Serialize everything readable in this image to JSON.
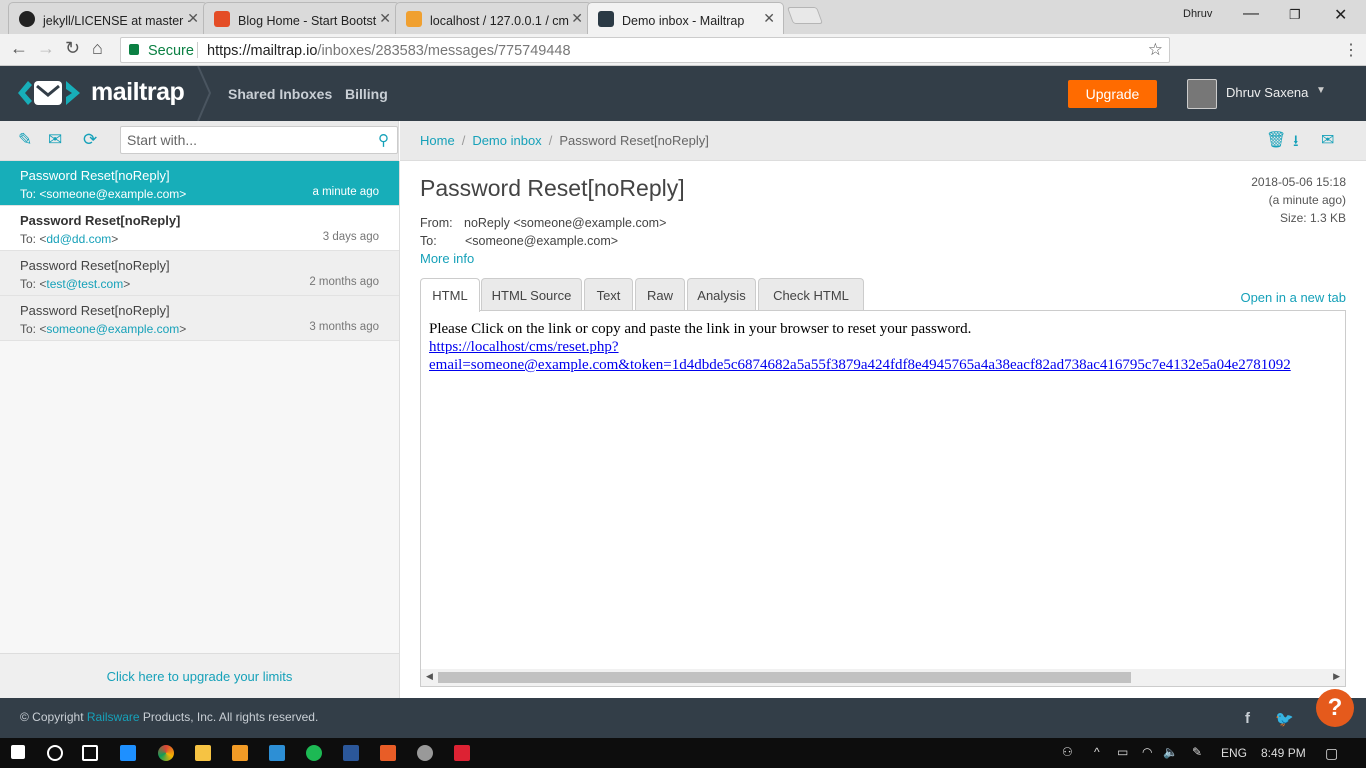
{
  "browser": {
    "tabs": [
      {
        "title": "jekyll/LICENSE at master ·",
        "favicon": "github-icon",
        "active": false
      },
      {
        "title": "Blog Home - Start Bootst",
        "favicon": "html5-icon",
        "active": false
      },
      {
        "title": "localhost / 127.0.0.1 / cm",
        "favicon": "phpmyadmin-icon",
        "active": false
      },
      {
        "title": "Demo inbox - Mailtrap",
        "favicon": "mailtrap-icon",
        "active": true
      }
    ],
    "profile_name": "Dhruv",
    "security_label": "Secure",
    "url_base": "https://mailtrap.io",
    "url_path": "/inboxes/283583/messages/775749448"
  },
  "header": {
    "logo_text": "mailtrap",
    "nav": [
      "Shared Inboxes",
      "Billing"
    ],
    "upgrade_label": "Upgrade",
    "user_name": "Dhruv Saxena"
  },
  "sidebar": {
    "search_placeholder": "Start with...",
    "messages": [
      {
        "subject": "Password Reset[noReply]",
        "to_prefix": "To: ",
        "to_email": "<someone@example.com>",
        "time": "a minute ago",
        "state": "selected"
      },
      {
        "subject": "Password Reset[noReply]",
        "to_prefix": "To: <",
        "to_email": "dd@dd.com",
        "to_suffix": ">",
        "time": "3 days ago",
        "state": "unread"
      },
      {
        "subject": "Password Reset[noReply]",
        "to_prefix": "To: <",
        "to_email": "test@test.com",
        "to_suffix": ">",
        "time": "2 months ago",
        "state": "read"
      },
      {
        "subject": "Password Reset[noReply]",
        "to_prefix": "To: <",
        "to_email": "someone@example.com",
        "to_suffix": ">",
        "time": "3 months ago",
        "state": "read"
      }
    ],
    "upgrade_limits": "Click here to upgrade your limits"
  },
  "message": {
    "breadcrumb": [
      "Home",
      "Demo inbox",
      "Password Reset[noReply]"
    ],
    "subject": "Password Reset[noReply]",
    "date": "2018-05-06 15:18",
    "relative": "(a minute ago)",
    "size": "Size: 1.3 KB",
    "from_label": "From:",
    "from_value": "noReply <someone@example.com>",
    "to_label": "To:",
    "to_value": "<someone@example.com>",
    "more_info": "More info",
    "tabs": [
      "HTML",
      "HTML Source",
      "Text",
      "Raw",
      "Analysis",
      "Check HTML"
    ],
    "active_tab": "HTML",
    "open_new_tab": "Open in a new tab",
    "body_text": "Please Click on the link or copy and paste the link in your browser to reset your password.",
    "link_line1": "https://localhost/cms/reset.php?",
    "link_line2": "email=someone@example.com&token=1d4dbde5c6874682a5a55f3879a424fdf8e4945765a4a38eacf82ad738ac416795c7e4132e5a04e2781092"
  },
  "footer": {
    "copyright_prefix": "© Copyright ",
    "copyright_link": "Railsware",
    "copyright_suffix": " Products, Inc. All rights reserved."
  },
  "taskbar": {
    "language": "ENG",
    "time": "8:49 PM"
  },
  "colors": {
    "accent": "#17aeb9",
    "header_bg": "#333e48",
    "upgrade": "#ff6b00"
  }
}
